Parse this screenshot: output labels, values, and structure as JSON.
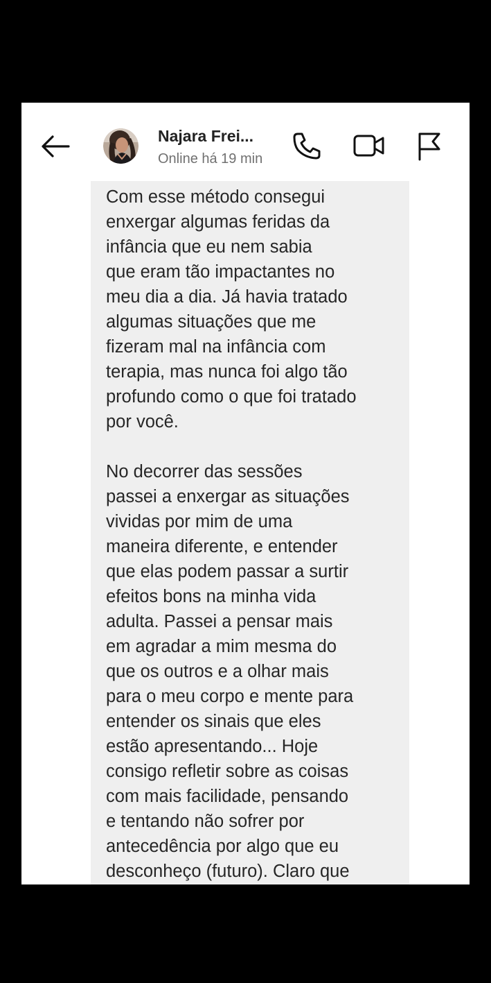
{
  "header": {
    "contact_name": "Najara Frei...",
    "status": "Online há 19 min",
    "icons": {
      "back": "arrow-left-icon",
      "call": "phone-icon",
      "video": "video-camera-icon",
      "report": "flag-icon"
    }
  },
  "message": {
    "paragraphs": [
      "Com esse método consegui\nenxergar algumas feridas da\ninfância que eu nem sabia\nque eram tão impactantes no\nmeu dia a dia. Já havia tratado\nalgumas situações que me\nfizeram mal na infância com\nterapia, mas nunca foi algo tão\nprofundo como o que foi tratado\npor você.",
      "No decorrer das sessões\npassei a enxergar as situações\nvividas por mim de uma\nmaneira diferente, e entender\nque elas podem passar a surtir\nefeitos bons na minha vida\nadulta. Passei a pensar mais\nem agradar a mim mesma do\nque os outros e a olhar mais\npara o meu corpo e mente para\nentender os sinais que eles\nestão apresentando... Hoje\nconsigo refletir sobre as coisas\ncom mais facilidade, pensando\ne tentando não sofrer por\nantecedência por algo que eu\ndesconheço (futuro). Claro que"
    ]
  },
  "colors": {
    "page_background": "#000000",
    "screen_background": "#ffffff",
    "bubble_background": "#efefef",
    "text_primary": "#262626",
    "text_secondary": "#707070",
    "icon_color": "#111111"
  }
}
